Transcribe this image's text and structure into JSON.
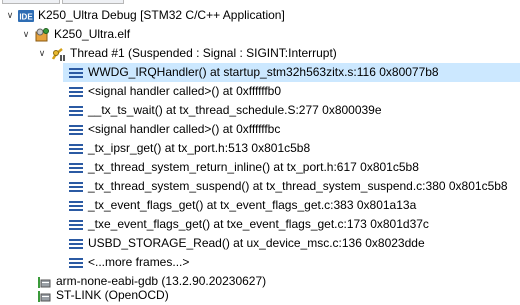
{
  "tree": {
    "launch": {
      "label": "K250_Ultra Debug [STM32 C/C++ Application]",
      "icon": "ide-launch-icon",
      "badge": "IDE"
    },
    "elf": {
      "label": "K250_Ultra.elf",
      "icon": "elf-process-icon"
    },
    "thread": {
      "label": "Thread #1 (Suspended : Signal : SIGINT:Interrupt)",
      "icon": "suspended-thread-icon"
    },
    "frames": [
      {
        "label": "WWDG_IRQHandler() at startup_stm32h563zitx.s:116 0x80077b8"
      },
      {
        "label": "<signal handler called>() at 0xffffffb0"
      },
      {
        "label": "__tx_ts_wait() at tx_thread_schedule.S:277 0x800039e"
      },
      {
        "label": "<signal handler called>() at 0xffffffbc"
      },
      {
        "label": "_tx_ipsr_get() at tx_port.h:513 0x801c5b8"
      },
      {
        "label": "_tx_thread_system_return_inline() at tx_port.h:617 0x801c5b8"
      },
      {
        "label": "_tx_thread_system_suspend() at tx_thread_system_suspend.c:380 0x801c5b8"
      },
      {
        "label": "_tx_event_flags_get() at tx_event_flags_get.c:383 0x801a13a"
      },
      {
        "label": "_txe_event_flags_get() at txe_event_flags_get.c:173 0x801d37c"
      },
      {
        "label": "USBD_STORAGE_Read() at ux_device_msc.c:136 0x8023dde"
      },
      {
        "label": "<...more frames...>"
      }
    ],
    "gdb": {
      "label": "arm-none-eabi-gdb (13.2.90.20230627)",
      "icon": "gdb-process-icon"
    },
    "stlink": {
      "label": "ST-LINK (OpenOCD)",
      "icon": "stlink-process-icon"
    }
  },
  "colors": {
    "selection": "#cce8ff",
    "frame_icon": "#2b5aa3",
    "ide_badge": "#2e6db4",
    "text": "#000000"
  }
}
